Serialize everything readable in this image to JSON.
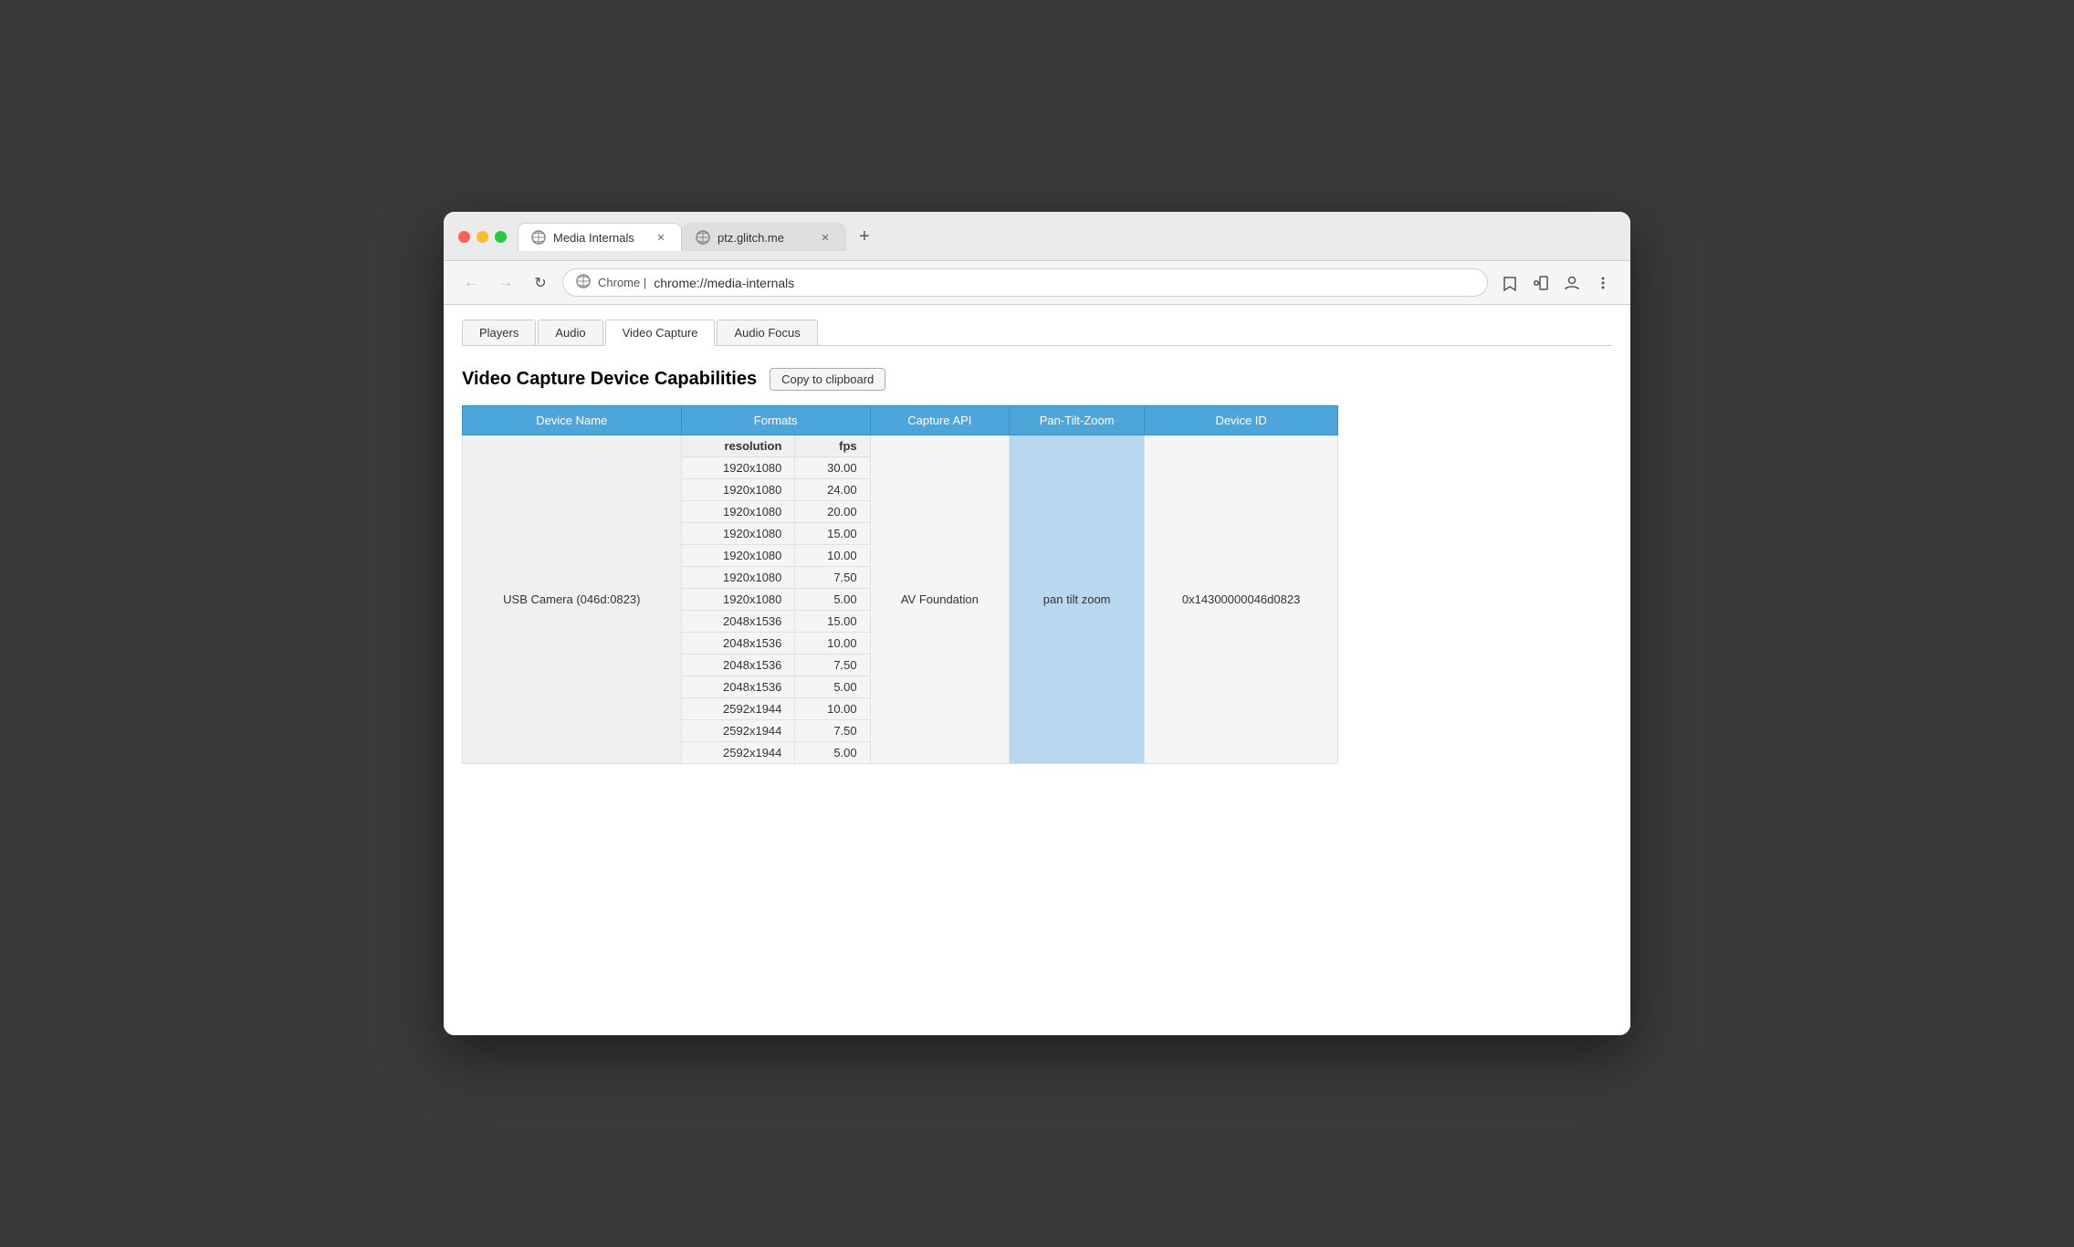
{
  "window": {
    "title": "Media Internals",
    "tab1": {
      "title": "Media Internals",
      "url": "chrome://media-internals"
    },
    "tab2": {
      "title": "ptz.glitch.me",
      "url": "ptz.glitch.me"
    },
    "address_bar": {
      "protocol": "Chrome  |",
      "url": "chrome://media-internals"
    }
  },
  "internal_tabs": [
    {
      "label": "Players",
      "active": false
    },
    {
      "label": "Audio",
      "active": false
    },
    {
      "label": "Video Capture",
      "active": true
    },
    {
      "label": "Audio Focus",
      "active": false
    }
  ],
  "section": {
    "title": "Video Capture Device Capabilities",
    "copy_button": "Copy to clipboard"
  },
  "table": {
    "headers": [
      "Device Name",
      "Formats",
      "Capture API",
      "Pan-Tilt-Zoom",
      "Device ID"
    ],
    "formats_subheaders": [
      "resolution",
      "fps"
    ],
    "device_name": "USB Camera (046d:0823)",
    "capture_api": "AV Foundation",
    "pan_tilt_zoom": "pan tilt zoom",
    "device_id": "0x14300000046d0823",
    "rows": [
      {
        "resolution": "1920x1080",
        "fps": "30.00"
      },
      {
        "resolution": "1920x1080",
        "fps": "24.00"
      },
      {
        "resolution": "1920x1080",
        "fps": "20.00"
      },
      {
        "resolution": "1920x1080",
        "fps": "15.00"
      },
      {
        "resolution": "1920x1080",
        "fps": "10.00"
      },
      {
        "resolution": "1920x1080",
        "fps": "7.50"
      },
      {
        "resolution": "1920x1080",
        "fps": "5.00"
      },
      {
        "resolution": "2048x1536",
        "fps": "15.00"
      },
      {
        "resolution": "2048x1536",
        "fps": "10.00"
      },
      {
        "resolution": "2048x1536",
        "fps": "7.50"
      },
      {
        "resolution": "2048x1536",
        "fps": "5.00"
      },
      {
        "resolution": "2592x1944",
        "fps": "10.00"
      },
      {
        "resolution": "2592x1944",
        "fps": "7.50"
      },
      {
        "resolution": "2592x1944",
        "fps": "5.00"
      }
    ],
    "center_row_index": 6
  },
  "colors": {
    "table_header_bg": "#4da6d9",
    "pan_tilt_highlight": "#b8d8f0"
  }
}
